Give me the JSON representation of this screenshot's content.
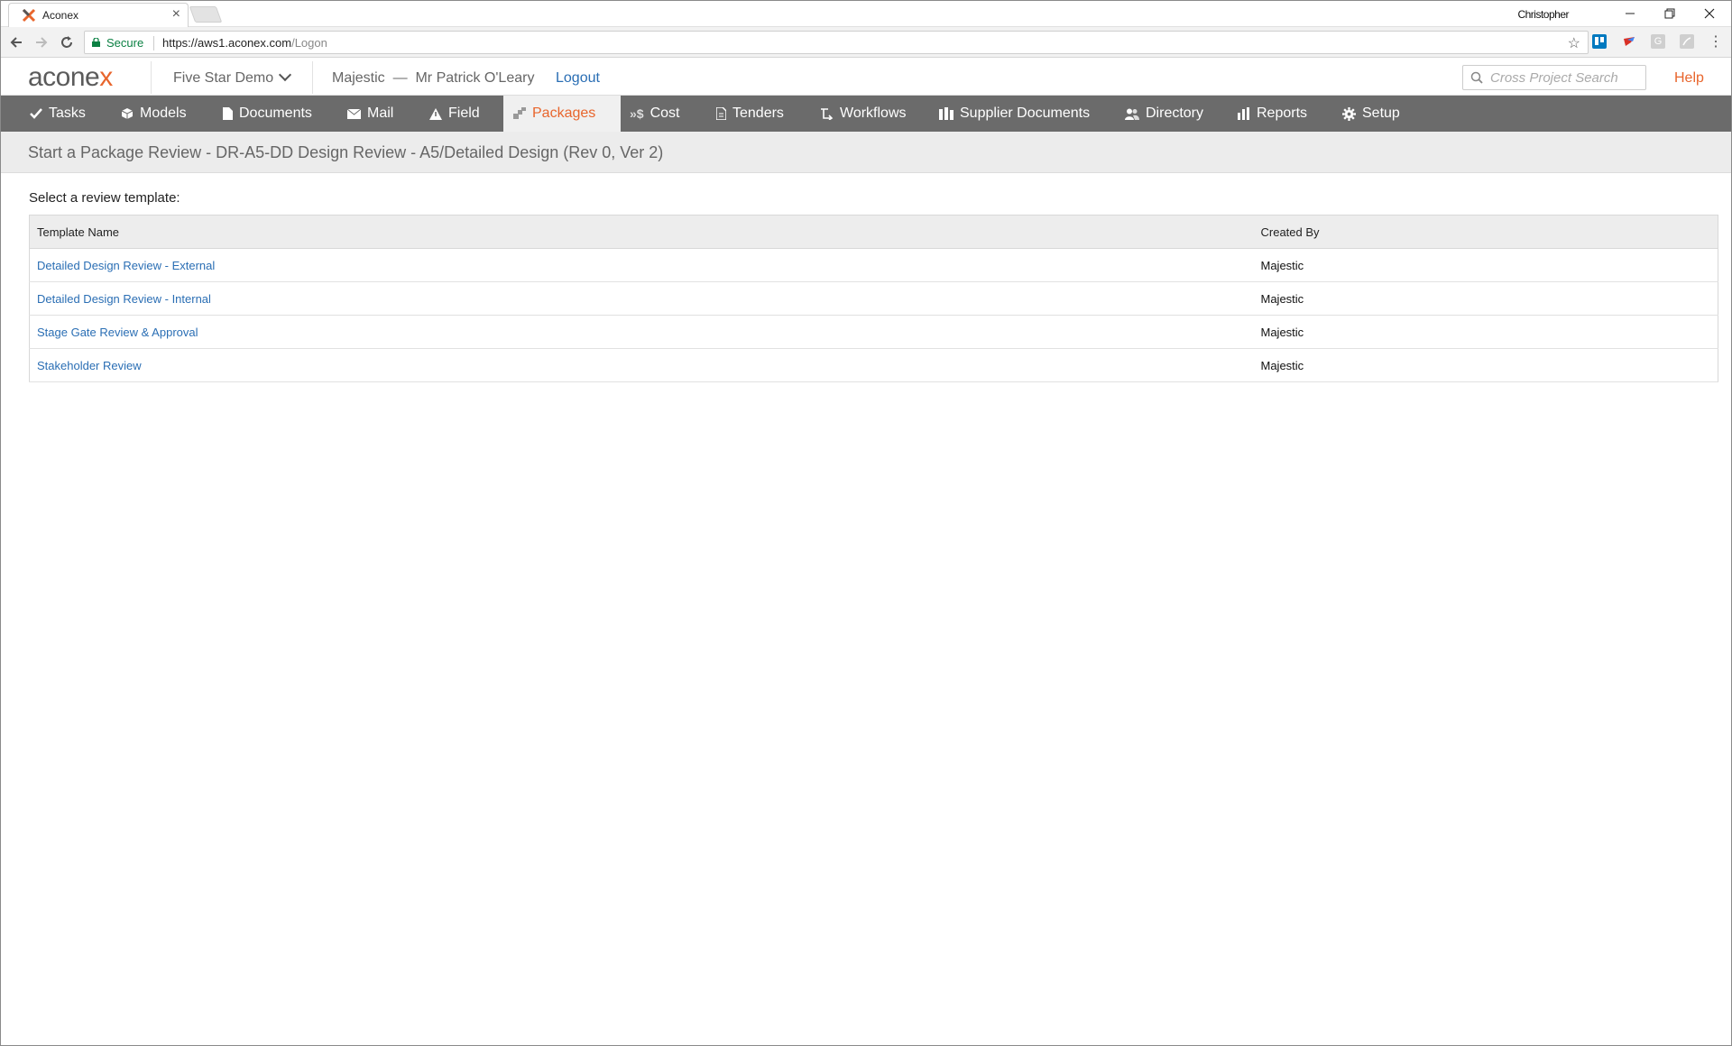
{
  "browser": {
    "tab_title": "Aconex",
    "user": "Christopher",
    "secure_label": "Secure",
    "url_host": "https://aws1.aconex.com",
    "url_path": "/Logon"
  },
  "header": {
    "logo_main": "acone",
    "logo_x": "x",
    "project": "Five Star Demo",
    "org": "Majestic",
    "separator": "—",
    "user_name": "Mr Patrick O'Leary",
    "logout": "Logout",
    "search_placeholder": "Cross Project Search",
    "help": "Help"
  },
  "nav": {
    "items": [
      {
        "label": "Tasks",
        "icon": "check-icon"
      },
      {
        "label": "Models",
        "icon": "cube-icon"
      },
      {
        "label": "Documents",
        "icon": "document-icon"
      },
      {
        "label": "Mail",
        "icon": "mail-icon"
      },
      {
        "label": "Field",
        "icon": "warning-icon"
      },
      {
        "label": "Packages",
        "icon": "packages-icon"
      },
      {
        "label": "Cost",
        "icon": "cost-icon"
      },
      {
        "label": "Tenders",
        "icon": "tender-icon"
      },
      {
        "label": "Workflows",
        "icon": "workflow-icon"
      },
      {
        "label": "Supplier Documents",
        "icon": "supplier-icon"
      },
      {
        "label": "Directory",
        "icon": "people-icon"
      },
      {
        "label": "Reports",
        "icon": "bar-chart-icon"
      },
      {
        "label": "Setup",
        "icon": "gear-icon"
      }
    ],
    "active": "Packages"
  },
  "page": {
    "title": "Start a Package Review - DR-A5-DD Design Review - A5/Detailed Design (Rev 0, Ver 2)",
    "select_label": "Select a review template:"
  },
  "table": {
    "headers": [
      "Template Name",
      "Created By"
    ],
    "rows": [
      {
        "name": "Detailed Design Review - External",
        "created_by": "Majestic"
      },
      {
        "name": "Detailed Design Review - Internal",
        "created_by": "Majestic"
      },
      {
        "name": "Stage Gate Review & Approval",
        "created_by": "Majestic"
      },
      {
        "name": "Stakeholder Review",
        "created_by": "Majestic"
      }
    ]
  },
  "colors": {
    "brand_orange": "#e8652c",
    "nav_bg": "#6b6b6b",
    "link_blue": "#2a6eb4"
  }
}
